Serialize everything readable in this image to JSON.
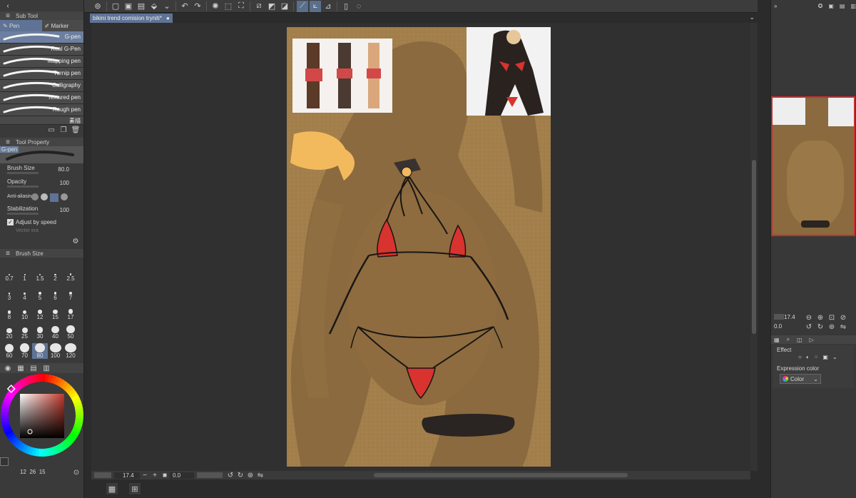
{
  "document_tab": "bikini trend comision tryniti*",
  "subtool": {
    "title": "Sub Tool",
    "tabs": [
      "Pen",
      "Marker"
    ],
    "brushes": [
      "G-pen",
      "Real G-Pen",
      "Mapping pen",
      "Turnip pen",
      "Calligraphy",
      "Textured pen",
      "Rough pen"
    ],
    "brush_cut": "素描"
  },
  "tool_property": {
    "title": "Tool Property",
    "tool_name": "G-pen",
    "brush_size_label": "Brush Size",
    "brush_size_value": "80.0",
    "opacity_label": "Opacity",
    "opacity_value": "100",
    "antialias_label": "Anti-aliasing",
    "stabilization_label": "Stabilization",
    "stabilization_value": "100",
    "adjust_label": "Adjust by speed",
    "vector_label": "Vector era"
  },
  "brush_size_palette": {
    "title": "Brush Size",
    "sizes": [
      "0.7",
      "1",
      "1.5",
      "2",
      "2.5",
      "3",
      "4",
      "5",
      "6",
      "7",
      "8",
      "10",
      "12",
      "15",
      "17",
      "20",
      "25",
      "30",
      "40",
      "50",
      "60",
      "70",
      "80",
      "100",
      "120"
    ],
    "selected": "80"
  },
  "color": {
    "hue_colors": [
      "#ff0000",
      "#ffff00",
      "#00ff00",
      "#00ffff",
      "#0000ff",
      "#ff00ff",
      "#ff0000"
    ],
    "main_color": "#c0392b",
    "footer": "12  26  15"
  },
  "navigator": {
    "zoom": "17.4",
    "rotation": "0.0"
  },
  "bottom": {
    "zoom": "17.4",
    "rotation": "0.0"
  },
  "layer_property": {
    "effect_label": "Effect",
    "expression_label": "Expression color",
    "expression_value": "Color"
  },
  "colors": {
    "paper": "#a37f4c",
    "silhouette": "#8a6a3e",
    "bikini_red": "#d8332f",
    "tan": "#f3b95d",
    "accent": "#5a6f8c"
  }
}
